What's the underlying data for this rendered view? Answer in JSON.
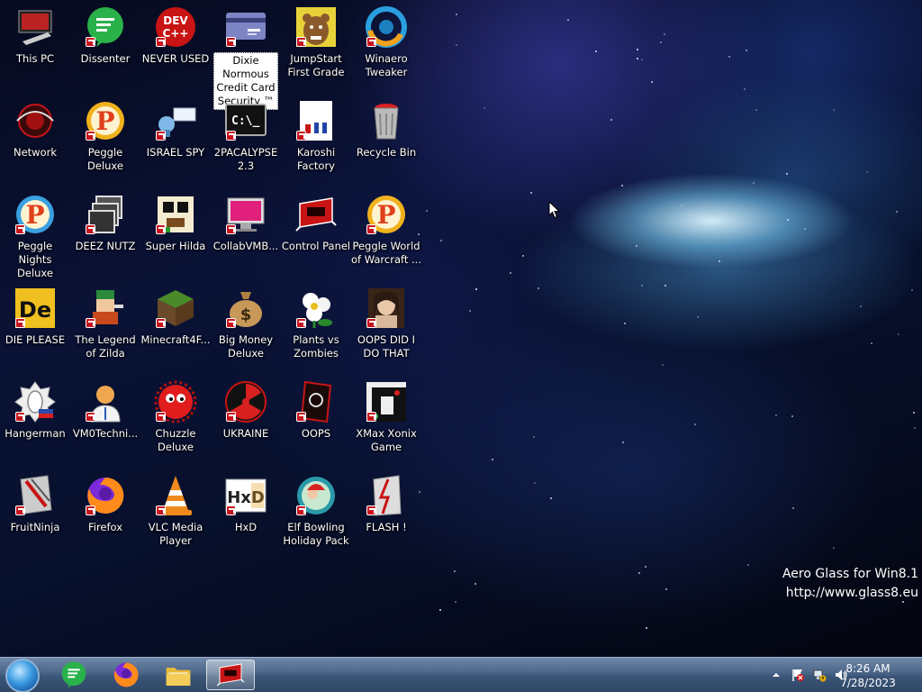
{
  "desktop": {
    "icons": [
      {
        "label": "This PC",
        "icon": "computer-icon"
      },
      {
        "label": "Dissenter",
        "icon": "dissenter-icon"
      },
      {
        "label": "NEVER USED",
        "icon": "devcpp-icon",
        "badge": "DEV\nC++"
      },
      {
        "label": "Dixie Normous Credit Card Security ™",
        "icon": "credit-card-icon",
        "selected": true
      },
      {
        "label": "JumpStart First Grade",
        "icon": "jumpstart-bear-icon"
      },
      {
        "label": "Winaero Tweaker",
        "icon": "winaero-icon"
      },
      {
        "label": "Network",
        "icon": "network-icon"
      },
      {
        "label": "Peggle Deluxe",
        "icon": "peggle-icon"
      },
      {
        "label": "ISRAEL SPY",
        "icon": "spy-icon"
      },
      {
        "label": "2PACALYPSE 2.3",
        "icon": "terminal-icon",
        "badge": "C:\\_"
      },
      {
        "label": "Karoshi Factory",
        "icon": "karoshi-icon"
      },
      {
        "label": "Recycle Bin",
        "icon": "recycle-bin-icon"
      },
      {
        "label": "Peggle Nights Deluxe",
        "icon": "peggle-nights-icon"
      },
      {
        "label": "DEEZ NUTZ",
        "icon": "windows-stack-icon"
      },
      {
        "label": "Super Hilda",
        "icon": "pixel-character-icon"
      },
      {
        "label": "CollabVMB...",
        "icon": "monitor-icon"
      },
      {
        "label": "Control Panel",
        "icon": "control-panel-icon"
      },
      {
        "label": "Peggle World of Warcraft ...",
        "icon": "peggle-wow-icon"
      },
      {
        "label": "DIE PLEASE",
        "icon": "die-icon",
        "badge": "De"
      },
      {
        "label": "The Legend of Zilda",
        "icon": "pixel-hero-icon"
      },
      {
        "label": "Minecraft4F...",
        "icon": "minecraft-block-icon"
      },
      {
        "label": "Big Money Deluxe",
        "icon": "money-bag-icon",
        "badge": "$"
      },
      {
        "label": "Plants vs Zombies",
        "icon": "flower-icon"
      },
      {
        "label": "OOPS DID I DO THAT",
        "icon": "portrait-icon"
      },
      {
        "label": "Hangerman",
        "icon": "hangerman-icon"
      },
      {
        "label": "VM0Techni...",
        "icon": "technician-icon"
      },
      {
        "label": "Chuzzle Deluxe",
        "icon": "chuzzle-icon"
      },
      {
        "label": "UKRAINE",
        "icon": "radiation-icon"
      },
      {
        "label": "OOPS",
        "icon": "oops-icon"
      },
      {
        "label": "XMax Xonix Game",
        "icon": "xonix-icon"
      },
      {
        "label": "FruitNinja",
        "icon": "fruitninja-icon"
      },
      {
        "label": "Firefox",
        "icon": "firefox-icon"
      },
      {
        "label": "VLC Media Player",
        "icon": "vlc-cone-icon"
      },
      {
        "label": "HxD",
        "icon": "hxd-icon",
        "badge": "HxD"
      },
      {
        "label": "Elf Bowling Holiday Pack",
        "icon": "elf-bowling-icon"
      },
      {
        "label": "FLASH !",
        "icon": "flash-icon"
      }
    ]
  },
  "watermark": {
    "line1": "Aero Glass for Win8.1",
    "line2": "http://www.glass8.eu"
  },
  "taskbar": {
    "pinned": [
      {
        "name": "dissenter",
        "icon": "dissenter-icon"
      },
      {
        "name": "firefox",
        "icon": "firefox-icon"
      },
      {
        "name": "file-explorer",
        "icon": "folder-icon"
      },
      {
        "name": "control-panel",
        "icon": "control-panel-icon",
        "active": true
      }
    ],
    "tray": {
      "time": "8:26 AM",
      "date": "7/28/2023"
    }
  },
  "colors": {
    "accent_red": "#c8141e",
    "taskbar_blue": "#4a6488",
    "dissenter_green": "#2ab24a",
    "firefox_orange": "#ff8a1c"
  }
}
